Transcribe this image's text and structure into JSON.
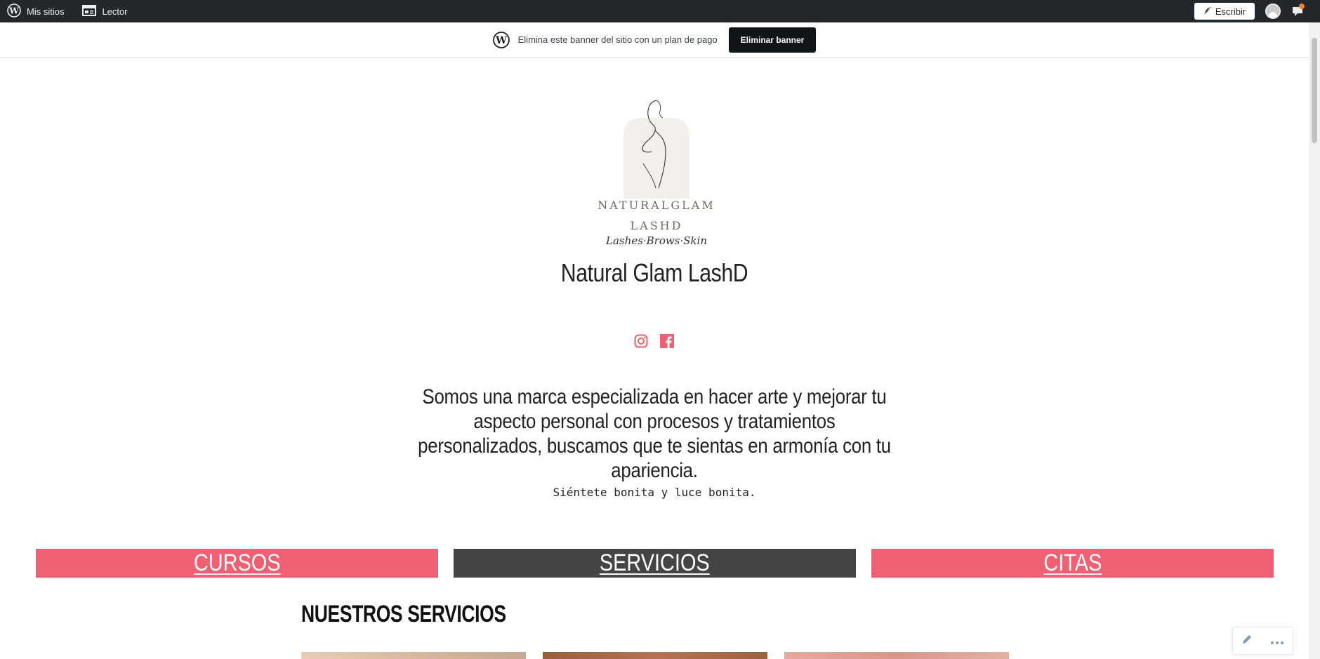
{
  "adminbar": {
    "my_sites_label": "Mis sitios",
    "reader_label": "Lector",
    "write_label": "Escribir",
    "icons": [
      "wordpress-icon",
      "reader-icon",
      "feather-icon",
      "avatar",
      "notifications-icon"
    ]
  },
  "banner": {
    "text": "Elimina este banner del sitio con un plan de pago",
    "button_label": "Eliminar banner"
  },
  "logo": {
    "line1": "NATURALGLAM",
    "line2": "LASHD",
    "script": "Lashes·Brows·Skin"
  },
  "site": {
    "title": "Natural Glam LashD",
    "intro": "Somos una marca especializada en hacer arte y mejorar tu aspecto personal con procesos y tratamientos personalizados, buscamos que te sientas en armonía con tu apariencia.",
    "tagline": "Siéntete bonita y luce bonita."
  },
  "social": [
    "instagram-icon",
    "facebook-icon"
  ],
  "nav_buttons": [
    {
      "label": "CURSOS",
      "color": "#f06072"
    },
    {
      "label": "SERVICIOS",
      "color": "#444444"
    },
    {
      "label": "CITAS",
      "color": "#f06072"
    }
  ],
  "section": {
    "title": "NUESTROS SERVICIOS"
  },
  "colors": {
    "accent_pink": "#f06072",
    "dark_button": "#444444",
    "adminbar": "#23282d"
  }
}
